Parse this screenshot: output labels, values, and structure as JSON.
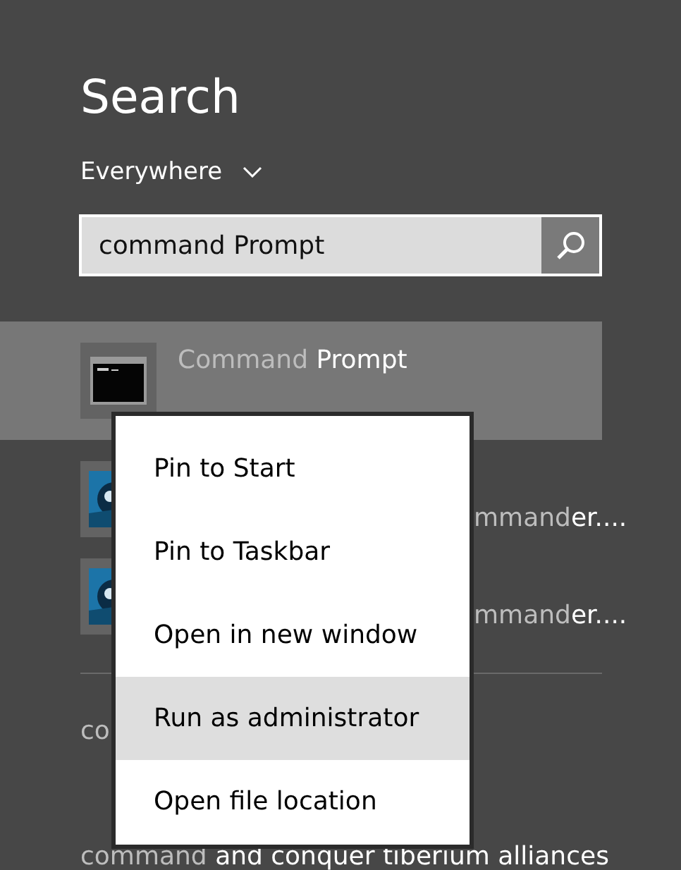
{
  "title": "Search",
  "scope": {
    "label": "Everywhere"
  },
  "search": {
    "value": "command Prompt"
  },
  "results": [
    {
      "kind": "terminal",
      "selected": true,
      "segments": [
        {
          "text": "Command ",
          "bright": false
        },
        {
          "text": "Prompt",
          "bright": true
        }
      ]
    },
    {
      "kind": "game",
      "selected": false,
      "segments": [
        {
          "text": "mmand",
          "bright": false
        },
        {
          "text": "er....",
          "bright": true
        }
      ]
    },
    {
      "kind": "game",
      "selected": false,
      "segments": [
        {
          "text": "mmand",
          "bright": false
        },
        {
          "text": "er....",
          "bright": true
        }
      ]
    }
  ],
  "suggestions": [
    {
      "segments": [
        {
          "text": "co",
          "bright": false
        }
      ]
    },
    {
      "segments": [
        {
          "text": "command",
          "bright": false
        },
        {
          "text": " and conquer tiberium alliances",
          "bright": true
        }
      ]
    }
  ],
  "context_menu": [
    {
      "label": "Pin to Start",
      "selected": false
    },
    {
      "label": "Pin to Taskbar",
      "selected": false
    },
    {
      "label": "Open in new window",
      "selected": false
    },
    {
      "label": "Run as administrator",
      "selected": true
    },
    {
      "label": "Open file location",
      "selected": false
    }
  ]
}
